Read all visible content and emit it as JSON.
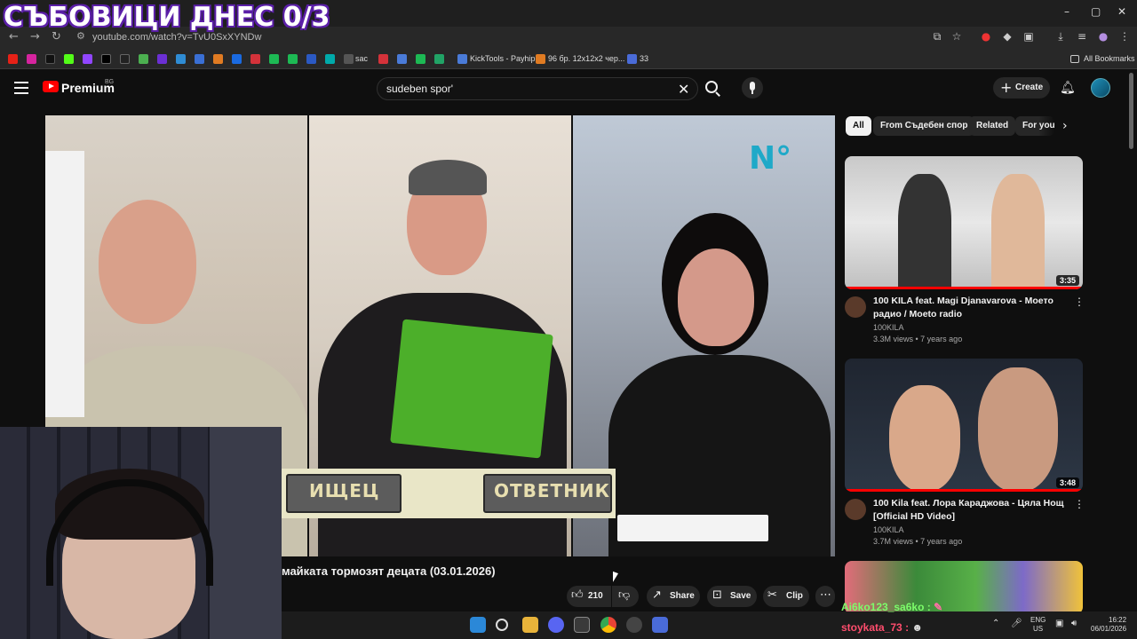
{
  "overlay": {
    "title": "СЪБОВИЦИ ДНЕС 0/3"
  },
  "browser": {
    "url": "youtube.com/watch?v=TvU0SxXYNDw",
    "bookmarks": [
      {
        "label": "sac"
      },
      {
        "label": "KickTools - Payhip"
      },
      {
        "label": "96 бр. 12х12х2 чер..."
      },
      {
        "label": "33"
      }
    ],
    "all_bookmarks": "All Bookmarks",
    "controls": {
      "minimize": "–",
      "maximize": "▢",
      "close": "✕"
    }
  },
  "youtube": {
    "logo_text": "Premium",
    "country_code": "BG",
    "search": {
      "value": "sudeben spor'"
    },
    "create_label": "Create"
  },
  "video": {
    "title": "майката тормозят децата (03.01.2026)",
    "sign_left": "ИЩЕЦ",
    "sign_right": "ОТВЕТНИК",
    "channel_logo": "N°",
    "actions": {
      "likes": "210",
      "share": "Share",
      "save": "Save",
      "clip": "Clip"
    }
  },
  "sidebar": {
    "chips": [
      "All",
      "From Съдебен спор",
      "Related",
      "For you"
    ],
    "recommendations": [
      {
        "title": "100 KILA feat. Magi Djanavarova - Моето радио / Moeto radio",
        "channel": "100KILA",
        "meta": "3.3M views • 7 years ago",
        "duration": "3:35"
      },
      {
        "title": "100 Kila feat. Лора Караджова - Цяла Нощ [Official HD Video]",
        "channel": "100KILA",
        "meta": "3.7M views • 7 years ago",
        "duration": "3:48"
      }
    ]
  },
  "chat": [
    {
      "user": "Ai6ko123_sa6ko",
      "sep": ":"
    },
    {
      "user": "stoykata_73",
      "sep": ":"
    }
  ],
  "taskbar": {
    "lang_top": "ENG",
    "lang_bottom": "US",
    "time": "16:22",
    "date": "06/01/2026"
  },
  "colors": {
    "accent_red": "#ff0000",
    "overlay_purple": "#5b1fa8",
    "chat_user_1": "#7cfc6a",
    "chat_user_2": "#ff4d6d"
  }
}
